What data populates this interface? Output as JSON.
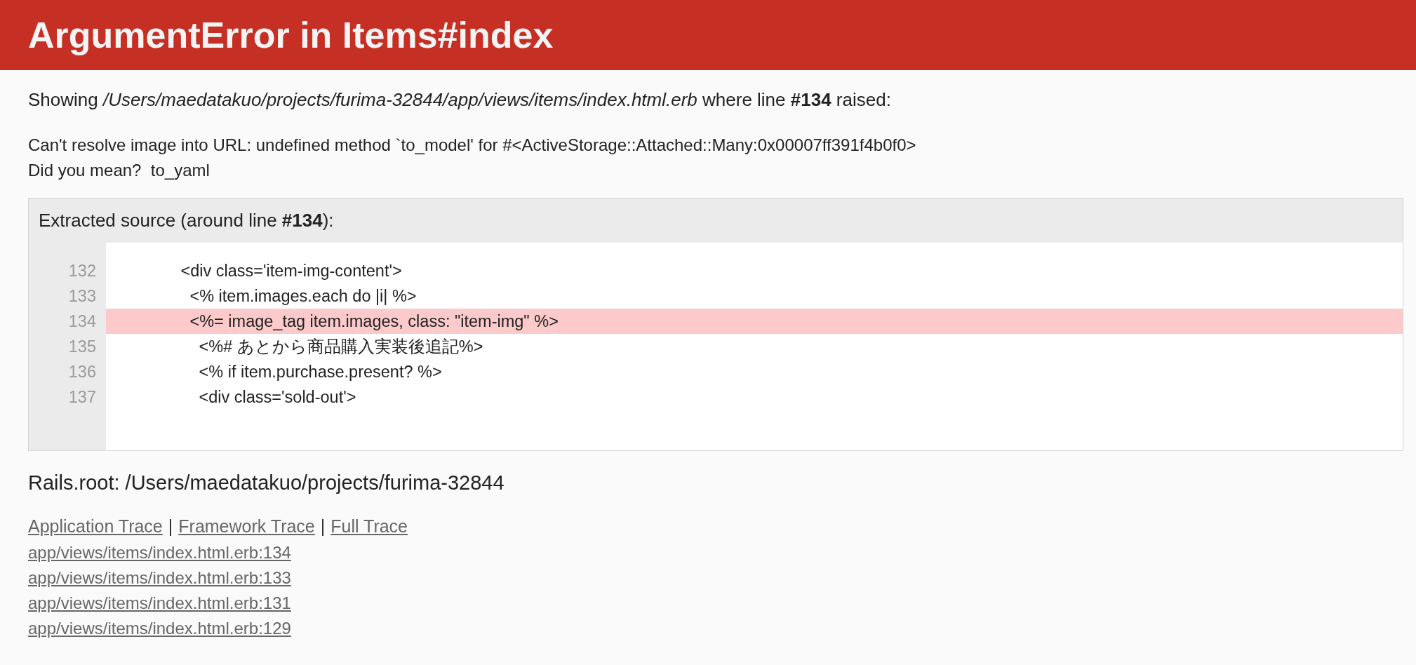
{
  "header": {
    "title": "ArgumentError in Items#index"
  },
  "summary": "Showing */Users/maedatakuo/projects/furima-32844/app/views/items/index.html.erb* where line **#134** raised:",
  "message": {
    "text": "Can't resolve image into URL: undefined method `to_model' for #<ActiveStorage::Attached::Many:0x00007ff391f4b0f0>",
    "suggestion": "Did you mean?  to_yaml"
  },
  "source": {
    "heading": "Extracted source (around line **#134**):",
    "lines": [
      {
        "number": "132",
        "code": "              <div class='item-img-content'>",
        "highlighted": false
      },
      {
        "number": "133",
        "code": "                <% item.images.each do |i| %>",
        "highlighted": false
      },
      {
        "number": "134",
        "code": "                <%= image_tag item.images, class: \"item-img\" %>",
        "highlighted": true
      },
      {
        "number": "135",
        "code": "                  <%# あとから商品購入実装後追記%>",
        "highlighted": false
      },
      {
        "number": "136",
        "code": "                  <% if item.purchase.present? %>",
        "highlighted": false
      },
      {
        "number": "137",
        "code": "                  <div class='sold-out'>",
        "highlighted": false
      }
    ]
  },
  "rails_root": "Rails.root: /Users/maedatakuo/projects/furima-32844",
  "trace": {
    "tabs": [
      {
        "label": "Application Trace"
      },
      {
        "label": "Framework Trace"
      },
      {
        "label": "Full Trace"
      }
    ],
    "separators": [
      "|",
      "|"
    ],
    "frames": [
      "app/views/items/index.html.erb:134",
      "app/views/items/index.html.erb:133",
      "app/views/items/index.html.erb:131",
      "app/views/items/index.html.erb:129"
    ]
  }
}
